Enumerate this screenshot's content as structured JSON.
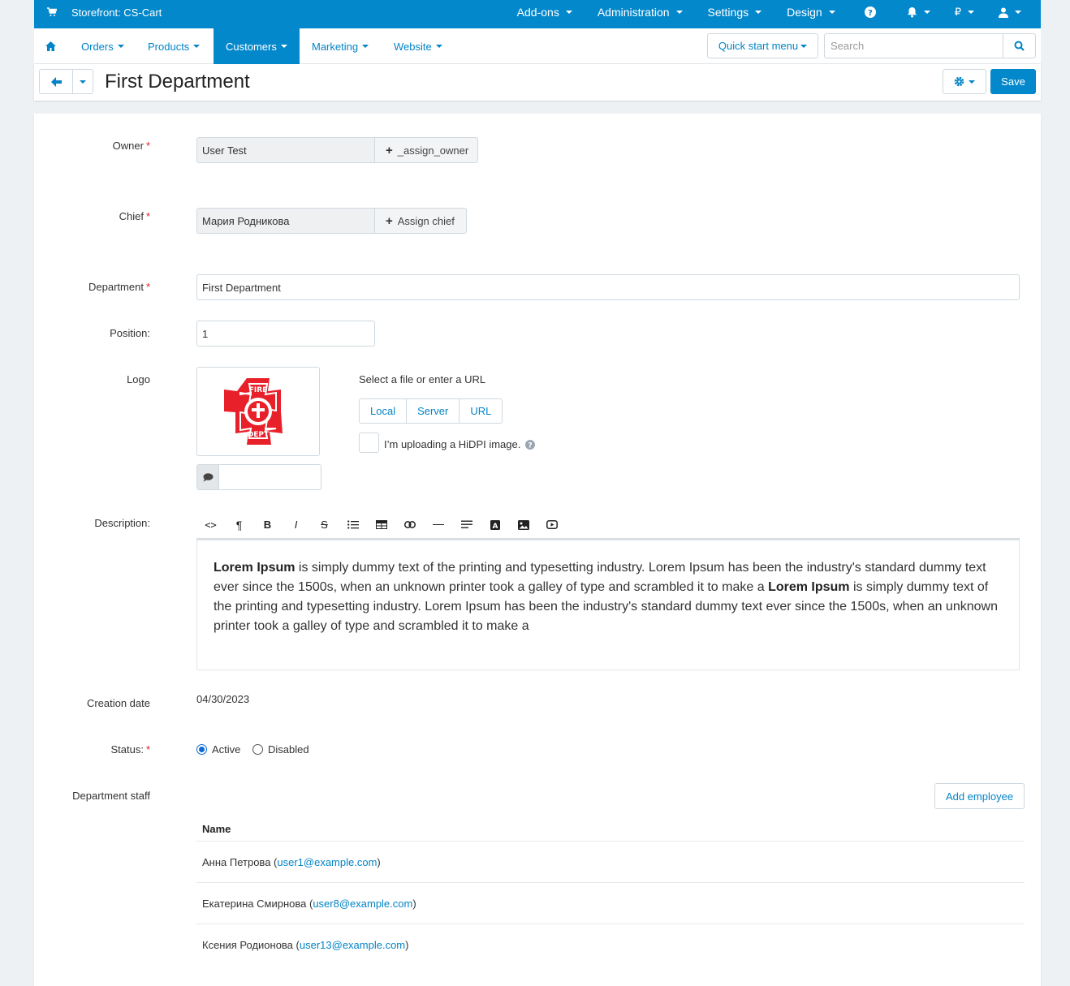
{
  "topbar": {
    "storefront": "Storefront: CS-Cart",
    "menu": [
      "Add-ons",
      "Administration",
      "Settings",
      "Design"
    ],
    "currency": "₽"
  },
  "nav": {
    "items": [
      "Orders",
      "Products",
      "Customers",
      "Marketing",
      "Website"
    ],
    "active": "Customers",
    "quick_start": "Quick start menu",
    "search_placeholder": "Search"
  },
  "page": {
    "title": "First Department",
    "save_label": "Save"
  },
  "form": {
    "owner": {
      "label": "Owner",
      "value": "User Test",
      "button": "_assign_owner"
    },
    "chief": {
      "label": "Chief",
      "value": "Мария Родникова",
      "button": "Assign chief"
    },
    "department": {
      "label": "Department",
      "value": "First Department"
    },
    "position": {
      "label": "Position:",
      "value": "1"
    },
    "logo": {
      "label": "Logo",
      "select_text": "Select a file or enter a URL",
      "sources": [
        "Local",
        "Server",
        "URL"
      ],
      "hidpi_label": "I’m uploading a HiDPI image.",
      "alt_value": ""
    },
    "description": {
      "label": "Description:",
      "bold1": "Lorem Ipsum",
      "text1": " is simply dummy text of the printing and typesetting industry. Lorem Ipsum has been the industry's standard dummy text ever since the 1500s, when an unknown printer took a galley of type and scrambled it to make a ",
      "bold2": "Lorem Ipsum",
      "text2": " is simply dummy text of the printing and typesetting industry. Lorem Ipsum has been the industry's standard dummy text ever since the 1500s, when an unknown printer took a galley of type and scrambled it to make a"
    },
    "creation_date": {
      "label": "Creation date",
      "value": "04/30/2023"
    },
    "status": {
      "label": "Status:",
      "options": [
        "Active",
        "Disabled"
      ],
      "selected": "Active"
    }
  },
  "staff": {
    "label": "Department staff",
    "add_button": "Add employee",
    "column": "Name",
    "rows": [
      {
        "name": "Анна Петрова",
        "email": "user1@example.com"
      },
      {
        "name": "Екатерина Смирнова",
        "email": "user8@example.com"
      },
      {
        "name": "Ксения Родионова",
        "email": "user13@example.com"
      }
    ]
  },
  "colors": {
    "primary": "#0388cc",
    "required": "#e02020",
    "logo_red": "#e8202a"
  }
}
